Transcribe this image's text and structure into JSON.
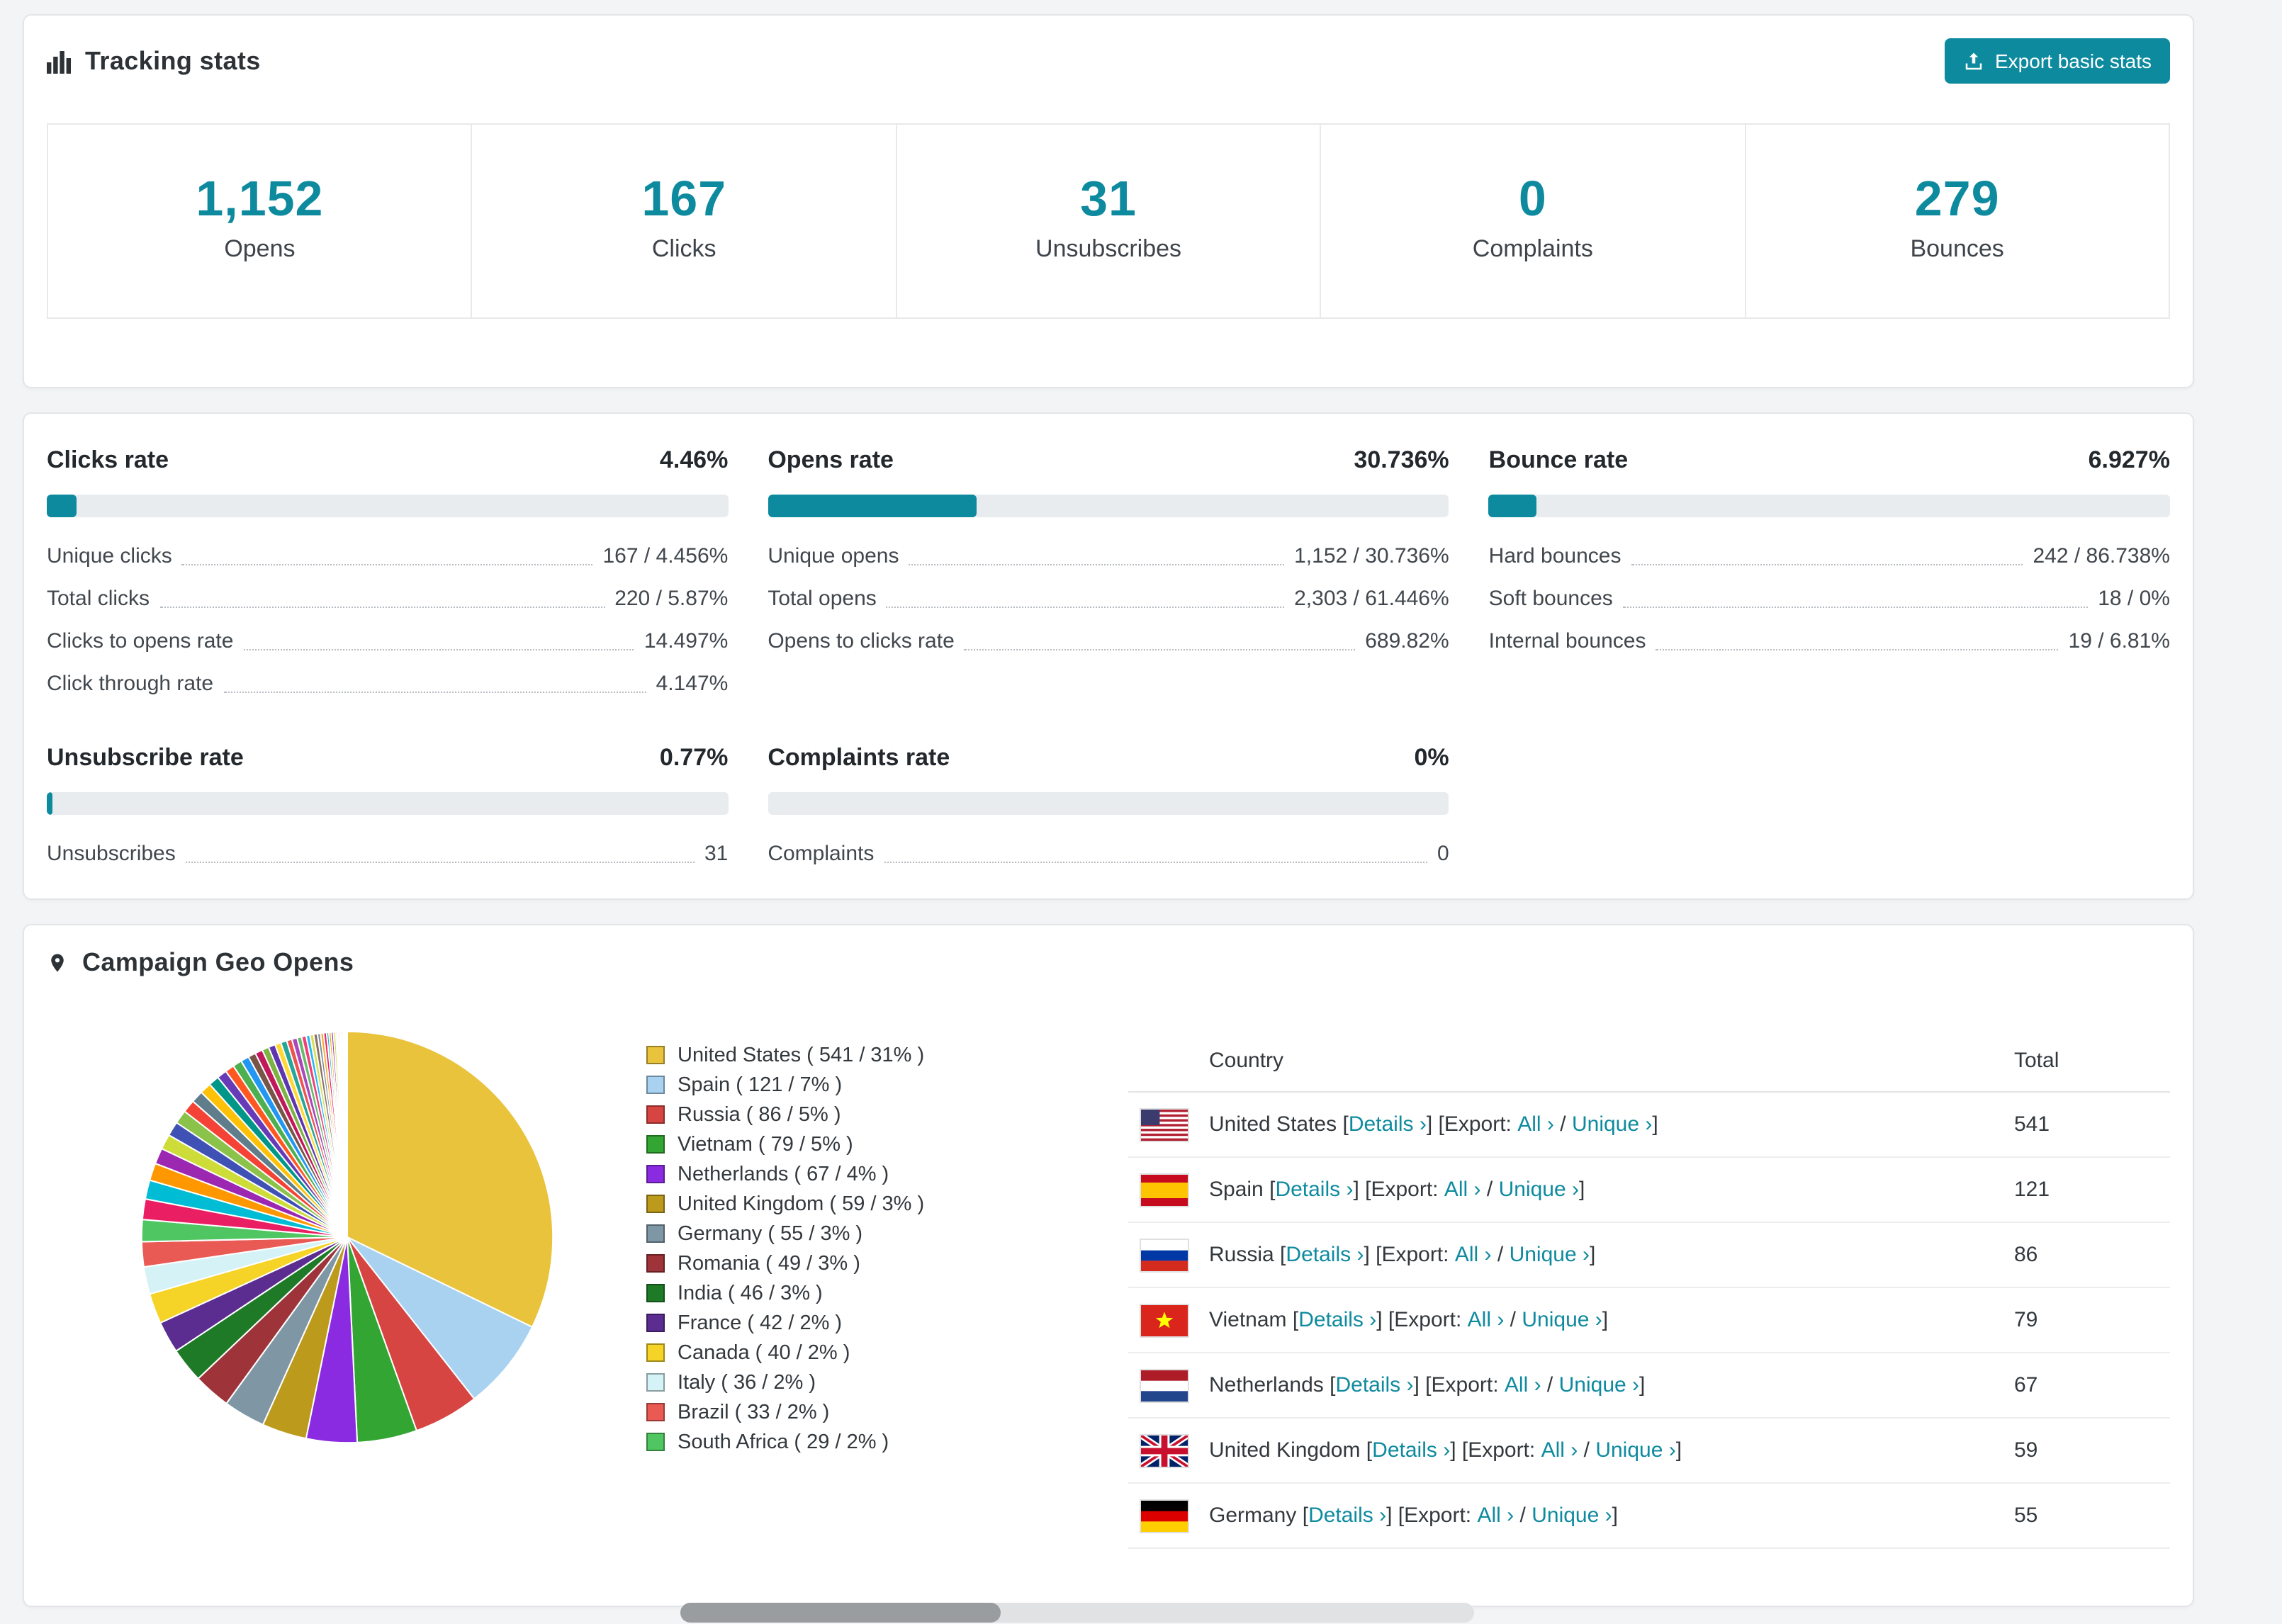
{
  "accent": "#0e8a9f",
  "tracking": {
    "title": "Tracking stats",
    "export_button": "Export basic stats",
    "stats": [
      {
        "value": "1,152",
        "label": "Opens"
      },
      {
        "value": "167",
        "label": "Clicks"
      },
      {
        "value": "31",
        "label": "Unsubscribes"
      },
      {
        "value": "0",
        "label": "Complaints"
      },
      {
        "value": "279",
        "label": "Bounces"
      }
    ]
  },
  "rates": [
    {
      "title": "Clicks rate",
      "value": "4.46%",
      "percent": 4.46,
      "rows": [
        {
          "label": "Unique clicks",
          "value": "167 / 4.456%"
        },
        {
          "label": "Total clicks",
          "value": "220 / 5.87%"
        },
        {
          "label": "Clicks to opens rate",
          "value": "14.497%"
        },
        {
          "label": "Click through rate",
          "value": "4.147%"
        }
      ]
    },
    {
      "title": "Opens rate",
      "value": "30.736%",
      "percent": 30.736,
      "rows": [
        {
          "label": "Unique opens",
          "value": "1,152 / 30.736%"
        },
        {
          "label": "Total opens",
          "value": "2,303 / 61.446%"
        },
        {
          "label": "Opens to clicks rate",
          "value": "689.82%"
        }
      ]
    },
    {
      "title": "Bounce rate",
      "value": "6.927%",
      "percent": 6.927,
      "rows": [
        {
          "label": "Hard bounces",
          "value": "242 / 86.738%"
        },
        {
          "label": "Soft bounces",
          "value": "18 / 0%"
        },
        {
          "label": "Internal bounces",
          "value": "19 / 6.81%"
        }
      ]
    },
    {
      "title": "Unsubscribe rate",
      "value": "0.77%",
      "percent": 0.77,
      "rows": [
        {
          "label": "Unsubscribes",
          "value": "31"
        }
      ]
    },
    {
      "title": "Complaints rate",
      "value": "0%",
      "percent": 0,
      "rows": [
        {
          "label": "Complaints",
          "value": "0"
        }
      ]
    }
  ],
  "geo": {
    "title": "Campaign Geo Opens",
    "chart_data": {
      "type": "pie",
      "title": "Campaign Geo Opens",
      "legend_position": "right",
      "slices": [
        {
          "label": "United States",
          "value": 541,
          "pct": 31,
          "color": "#e8c33b"
        },
        {
          "label": "Spain",
          "value": 121,
          "pct": 7,
          "color": "#a8d2f0"
        },
        {
          "label": "Russia",
          "value": 86,
          "pct": 5,
          "color": "#d64541"
        },
        {
          "label": "Vietnam",
          "value": 79,
          "pct": 5,
          "color": "#33a532"
        },
        {
          "label": "Netherlands",
          "value": 67,
          "pct": 4,
          "color": "#8a2be2"
        },
        {
          "label": "United Kingdom",
          "value": 59,
          "pct": 3,
          "color": "#bb9a1c"
        },
        {
          "label": "Germany",
          "value": 55,
          "pct": 3,
          "color": "#7f96a5"
        },
        {
          "label": "Romania",
          "value": 49,
          "pct": 3,
          "color": "#9e3339"
        },
        {
          "label": "India",
          "value": 46,
          "pct": 3,
          "color": "#1f7a28"
        },
        {
          "label": "France",
          "value": 42,
          "pct": 2,
          "color": "#5b2d90"
        },
        {
          "label": "Canada",
          "value": 40,
          "pct": 2,
          "color": "#f5d327"
        },
        {
          "label": "Italy",
          "value": 36,
          "pct": 2,
          "color": "#d5f2f7"
        },
        {
          "label": "Brazil",
          "value": 33,
          "pct": 2,
          "color": "#ea5a55"
        },
        {
          "label": "South Africa",
          "value": 29,
          "pct": 2,
          "color": "#4fc662"
        }
      ],
      "other_slices": [
        27,
        25,
        23,
        21,
        20,
        19,
        18,
        17,
        16,
        15,
        14,
        13,
        12,
        12,
        11,
        10,
        10,
        9,
        9,
        8,
        8,
        7,
        7,
        6,
        6,
        5,
        5,
        5,
        4,
        4,
        4,
        3,
        3,
        3,
        3,
        2,
        2,
        2,
        2,
        2,
        1,
        1,
        1,
        1,
        1
      ],
      "other_palette": [
        "#e91e63",
        "#00bcd4",
        "#ff9800",
        "#9c27b0",
        "#cddc39",
        "#3f51b5",
        "#8bc34a",
        "#f44336",
        "#607d8b",
        "#ffc107",
        "#009688",
        "#673ab7",
        "#ff5722",
        "#4caf50",
        "#2196f3",
        "#795548",
        "#c2185b",
        "#7cb342",
        "#5e35b1",
        "#fdd835",
        "#26a69a",
        "#ef5350",
        "#ab47bc",
        "#66bb6a",
        "#ec407a",
        "#29b6f6",
        "#d4e157",
        "#8d6e63",
        "#78909c",
        "#ffa726"
      ]
    },
    "table": {
      "headers": [
        "Country",
        "Total"
      ],
      "link_labels": {
        "details": "Details ›",
        "export_prefix": "Export:",
        "all": "All ›",
        "unique": "Unique ›"
      },
      "rows": [
        {
          "country": "United States",
          "flag": "us",
          "total": 541
        },
        {
          "country": "Spain",
          "flag": "es",
          "total": 121
        },
        {
          "country": "Russia",
          "flag": "ru",
          "total": 86
        },
        {
          "country": "Vietnam",
          "flag": "vn",
          "total": 79
        },
        {
          "country": "Netherlands",
          "flag": "nl",
          "total": 67
        },
        {
          "country": "United Kingdom",
          "flag": "gb",
          "total": 59
        },
        {
          "country": "Germany",
          "flag": "de",
          "total": 55
        }
      ]
    }
  }
}
